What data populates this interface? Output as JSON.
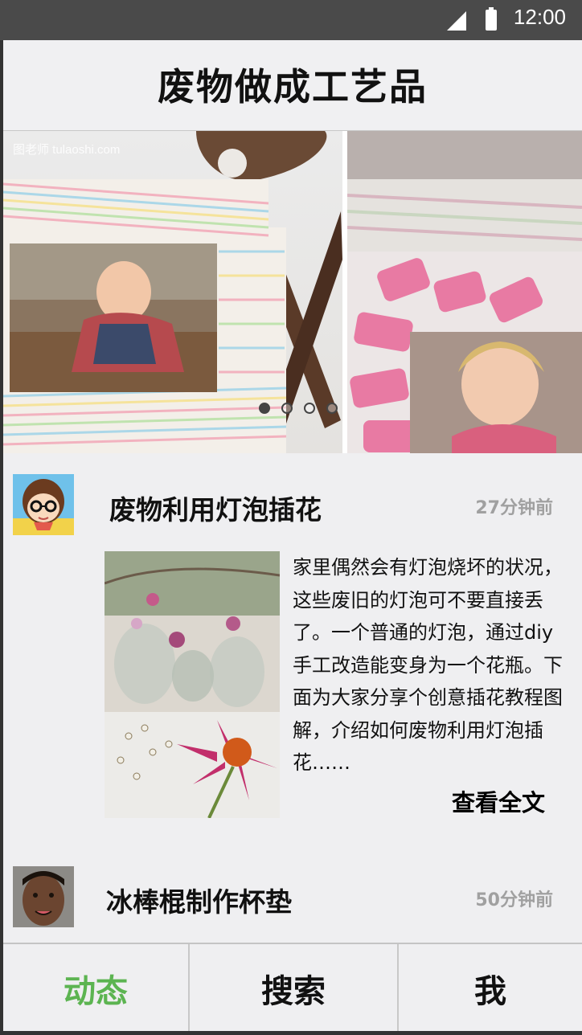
{
  "status_bar": {
    "time": "12:00"
  },
  "header": {
    "title": "废物做成工艺品"
  },
  "banner": {
    "watermark": "图老师 tulaoshi.com",
    "slides_count": 4,
    "active_slide": 1
  },
  "feed": [
    {
      "title": "废物利用灯泡插花",
      "time": "27分钟前",
      "excerpt": "家里偶然会有灯泡烧坏的状况，这些废旧的灯泡可不要直接丢了。一个普通的灯泡，通过diy手工改造能变身为一个花瓶。下面为大家分享个创意插花教程图解，介绍如何废物利用灯泡插花……",
      "read_more": "查看全文"
    },
    {
      "title": "冰棒棍制作杯垫",
      "time": "50分钟前"
    }
  ],
  "tabs": [
    {
      "label": "动态",
      "active": true
    },
    {
      "label": "搜索",
      "active": false
    },
    {
      "label": "我",
      "active": false
    }
  ],
  "colors": {
    "accent": "#5cb451",
    "status_bar": "#4a4a4a",
    "background": "#efeff1"
  }
}
